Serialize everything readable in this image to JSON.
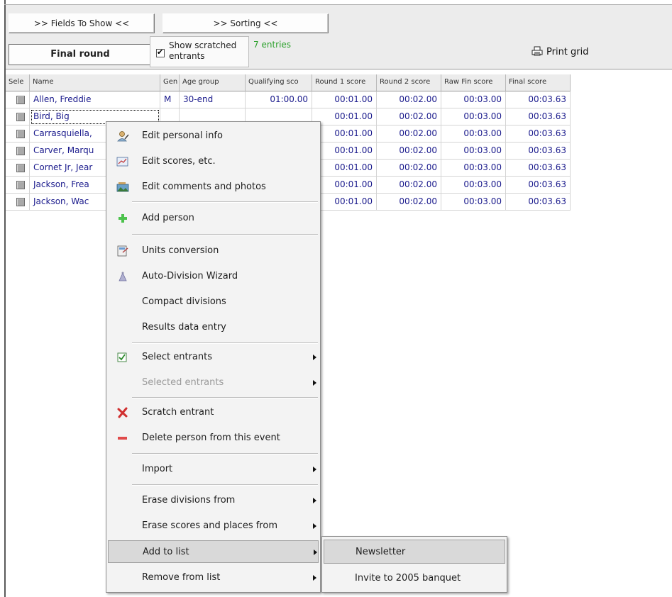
{
  "toolbar": {
    "fields_button": ">> Fields To Show <<",
    "sorting_button": ">> Sorting <<",
    "round_button": "Final round",
    "show_scratched_label": "Show scratched entrants",
    "show_scratched_checked": true,
    "entries": "7 entries",
    "print_grid": "Print grid"
  },
  "grid": {
    "columns": [
      "Sele",
      "Name",
      "Gen",
      "Age group",
      "Qualifying sco",
      "Round 1 score",
      "Round 2 score",
      "Raw Fin score",
      "Final score"
    ],
    "rows": [
      {
        "name": "Allen, Freddie",
        "gender": "M",
        "age_group": "30-end",
        "qualifying": "01:00.00",
        "round1": "00:01.00",
        "round2": "00:02.00",
        "raw_fin": "00:03.00",
        "final": "00:03.63"
      },
      {
        "name": "Bird, Big",
        "gender": "",
        "age_group": "",
        "qualifying": "",
        "round1": "00:01.00",
        "round2": "00:02.00",
        "raw_fin": "00:03.00",
        "final": "00:03.63"
      },
      {
        "name": "Carrasquiella,",
        "gender": "",
        "age_group": "",
        "qualifying": "",
        "round1": "00:01.00",
        "round2": "00:02.00",
        "raw_fin": "00:03.00",
        "final": "00:03.63"
      },
      {
        "name": "Carver, Marqu",
        "gender": "",
        "age_group": "",
        "qualifying": "",
        "round1": "00:01.00",
        "round2": "00:02.00",
        "raw_fin": "00:03.00",
        "final": "00:03.63"
      },
      {
        "name": "Cornet Jr, Jear",
        "gender": "",
        "age_group": "",
        "qualifying": "",
        "round1": "00:01.00",
        "round2": "00:02.00",
        "raw_fin": "00:03.00",
        "final": "00:03.63"
      },
      {
        "name": "Jackson, Frea",
        "gender": "",
        "age_group": "",
        "qualifying": "",
        "round1": "00:01.00",
        "round2": "00:02.00",
        "raw_fin": "00:03.00",
        "final": "00:03.63"
      },
      {
        "name": "Jackson, Wac",
        "gender": "",
        "age_group": "",
        "qualifying": "",
        "round1": "00:01.00",
        "round2": "00:02.00",
        "raw_fin": "00:03.00",
        "final": "00:03.63"
      }
    ]
  },
  "context_menu": {
    "edit_personal_info": "Edit personal info",
    "edit_scores": "Edit scores, etc.",
    "edit_comments": "Edit comments and photos",
    "add_person": "Add person",
    "units_conversion": "Units conversion",
    "auto_division": "Auto-Division Wizard",
    "compact_divisions": "Compact divisions",
    "results_entry": "Results data entry",
    "select_entrants": "Select entrants",
    "selected_entrants": "Selected entrants",
    "scratch_entrant": "Scratch entrant",
    "delete_person": "Delete person from this event",
    "import": "Import",
    "erase_divisions": "Erase divisions from",
    "erase_scores": "Erase scores and places from",
    "add_to_list": "Add to list",
    "remove_from_list": "Remove from list"
  },
  "submenu": {
    "newsletter": "Newsletter",
    "invite": "Invite to 2005 banquet"
  }
}
